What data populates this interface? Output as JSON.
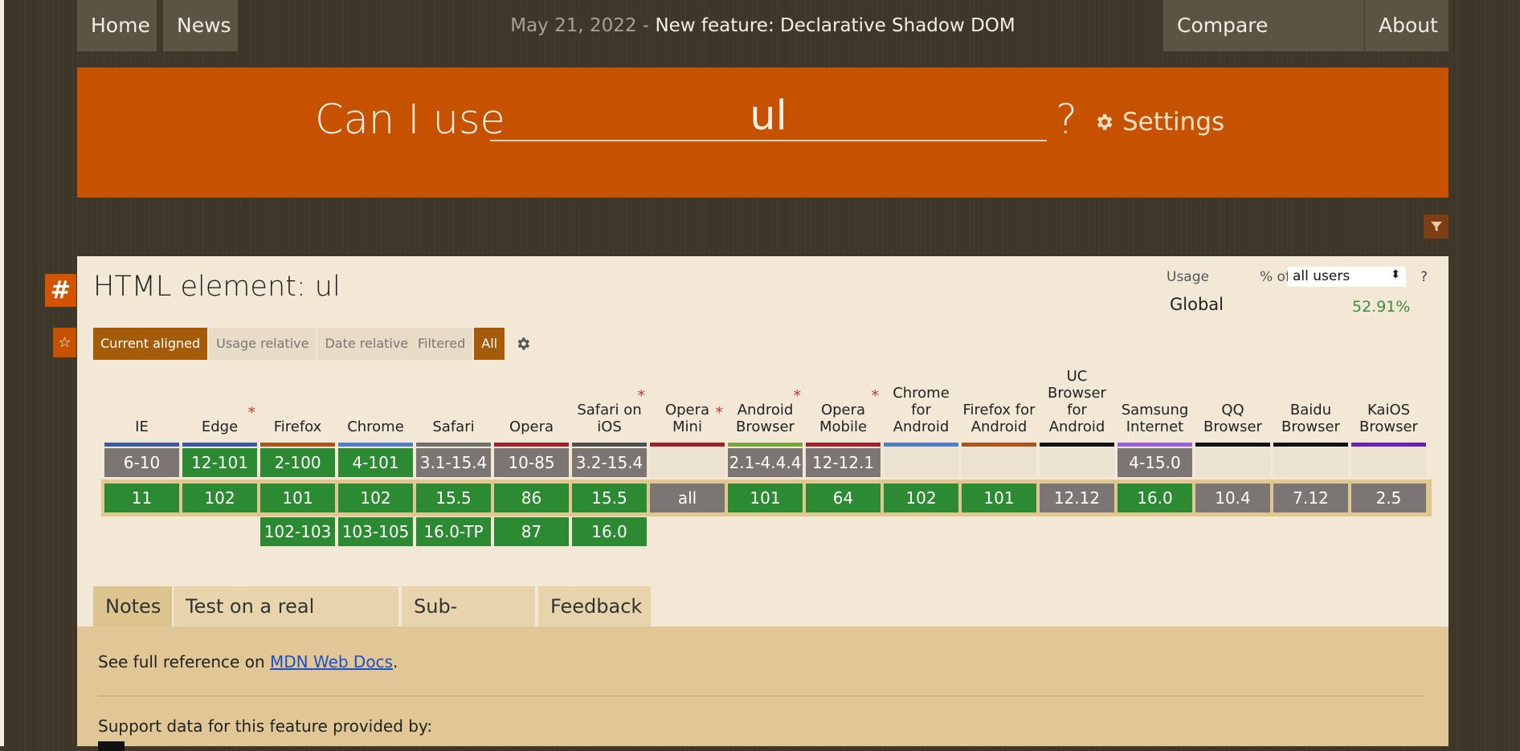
{
  "nav": {
    "home": "Home",
    "news": "News",
    "news_date": "May 21, 2022",
    "news_sep": " - ",
    "news_title": "New feature: Declarative Shadow DOM",
    "compare": "Compare browsers",
    "about": "About"
  },
  "search": {
    "prefix": "Can I use",
    "query": "ul",
    "suffix": "?",
    "settings": "Settings"
  },
  "feature": {
    "hash": "#",
    "star": "☆",
    "title": "HTML element: ul"
  },
  "usage": {
    "label": "Usage",
    "pct_of": "% of",
    "scope": "all users",
    "help": "?",
    "global_label": "Global",
    "global_value": "52.91%"
  },
  "toggles": {
    "current": "Current aligned",
    "usage_rel": "Usage relative",
    "date_rel": "Date relative",
    "filtered": "Filtered",
    "all": "All"
  },
  "browsers": [
    {
      "name": [
        "IE"
      ],
      "color": "#3c5aa6",
      "asterisk": false,
      "past": "6-10",
      "past_s": "n",
      "current": "11",
      "current_s": "y",
      "future": "",
      "future_s": ""
    },
    {
      "name": [
        "Edge"
      ],
      "color": "#3c5aa6",
      "asterisk": true,
      "past": "12-101",
      "past_s": "y",
      "current": "102",
      "current_s": "y",
      "future": "",
      "future_s": ""
    },
    {
      "name": [
        "Firefox"
      ],
      "color": "#a8561e",
      "asterisk": false,
      "past": "2-100",
      "past_s": "y",
      "current": "101",
      "current_s": "y",
      "future": "102-103",
      "future_s": "y"
    },
    {
      "name": [
        "Chrome"
      ],
      "color": "#4e7fc8",
      "asterisk": false,
      "past": "4-101",
      "past_s": "y",
      "current": "102",
      "current_s": "y",
      "future": "103-105",
      "future_s": "y"
    },
    {
      "name": [
        "Safari"
      ],
      "color": "#707070",
      "asterisk": false,
      "past": "3.1-15.4",
      "past_s": "n",
      "current": "15.5",
      "current_s": "y",
      "future": "16.0-TP",
      "future_s": "y"
    },
    {
      "name": [
        "Opera"
      ],
      "color": "#a12126",
      "asterisk": false,
      "past": "10-85",
      "past_s": "n",
      "current": "86",
      "current_s": "y",
      "future": "87",
      "future_s": "y"
    },
    {
      "name": [
        "Safari on",
        "iOS"
      ],
      "color": "#505050",
      "asterisk": true,
      "past": "3.2-15.4",
      "past_s": "n",
      "current": "15.5",
      "current_s": "y",
      "future": "16.0",
      "future_s": "y"
    },
    {
      "name": [
        "Opera Mini"
      ],
      "color": "#a12126",
      "asterisk": true,
      "past": "",
      "past_s": "e",
      "current": "all",
      "current_s": "n",
      "future": "",
      "future_s": ""
    },
    {
      "name": [
        "Android",
        "Browser"
      ],
      "color": "#79a33c",
      "asterisk": true,
      "past": "2.1-4.4.4",
      "past_s": "n",
      "current": "101",
      "current_s": "y",
      "future": "",
      "future_s": ""
    },
    {
      "name": [
        "Opera",
        "Mobile"
      ],
      "color": "#a12126",
      "asterisk": true,
      "past": "12-12.1",
      "past_s": "n",
      "current": "64",
      "current_s": "y",
      "future": "",
      "future_s": ""
    },
    {
      "name": [
        "Chrome",
        "for",
        "Android"
      ],
      "color": "#4e7fc8",
      "asterisk": false,
      "past": "",
      "past_s": "e",
      "current": "102",
      "current_s": "y",
      "future": "",
      "future_s": ""
    },
    {
      "name": [
        "Firefox for",
        "Android"
      ],
      "color": "#a8561e",
      "asterisk": false,
      "past": "",
      "past_s": "e",
      "current": "101",
      "current_s": "y",
      "future": "",
      "future_s": ""
    },
    {
      "name": [
        "UC",
        "Browser",
        "for",
        "Android"
      ],
      "color": "#111111",
      "asterisk": false,
      "past": "",
      "past_s": "e",
      "current": "12.12",
      "current_s": "n",
      "future": "",
      "future_s": ""
    },
    {
      "name": [
        "Samsung",
        "Internet"
      ],
      "color": "#9b5fe0",
      "asterisk": false,
      "past": "4-15.0",
      "past_s": "n",
      "current": "16.0",
      "current_s": "y",
      "future": "",
      "future_s": ""
    },
    {
      "name": [
        "QQ",
        "Browser"
      ],
      "color": "#111111",
      "asterisk": false,
      "past": "",
      "past_s": "e",
      "current": "10.4",
      "current_s": "n",
      "future": "",
      "future_s": ""
    },
    {
      "name": [
        "Baidu",
        "Browser"
      ],
      "color": "#111111",
      "asterisk": false,
      "past": "",
      "past_s": "e",
      "current": "7.12",
      "current_s": "n",
      "future": "",
      "future_s": ""
    },
    {
      "name": [
        "KaiOS",
        "Browser"
      ],
      "color": "#6b1fb5",
      "asterisk": false,
      "past": "",
      "past_s": "e",
      "current": "2.5",
      "current_s": "n",
      "future": "",
      "future_s": ""
    }
  ],
  "tabs": [
    "Notes",
    "Test on a real browser",
    "Sub-features",
    "Feedback"
  ],
  "notes": {
    "prefix": "See full reference on ",
    "link": "MDN Web Docs",
    "suffix": ".",
    "provided": "Support data for this feature provided by:"
  }
}
